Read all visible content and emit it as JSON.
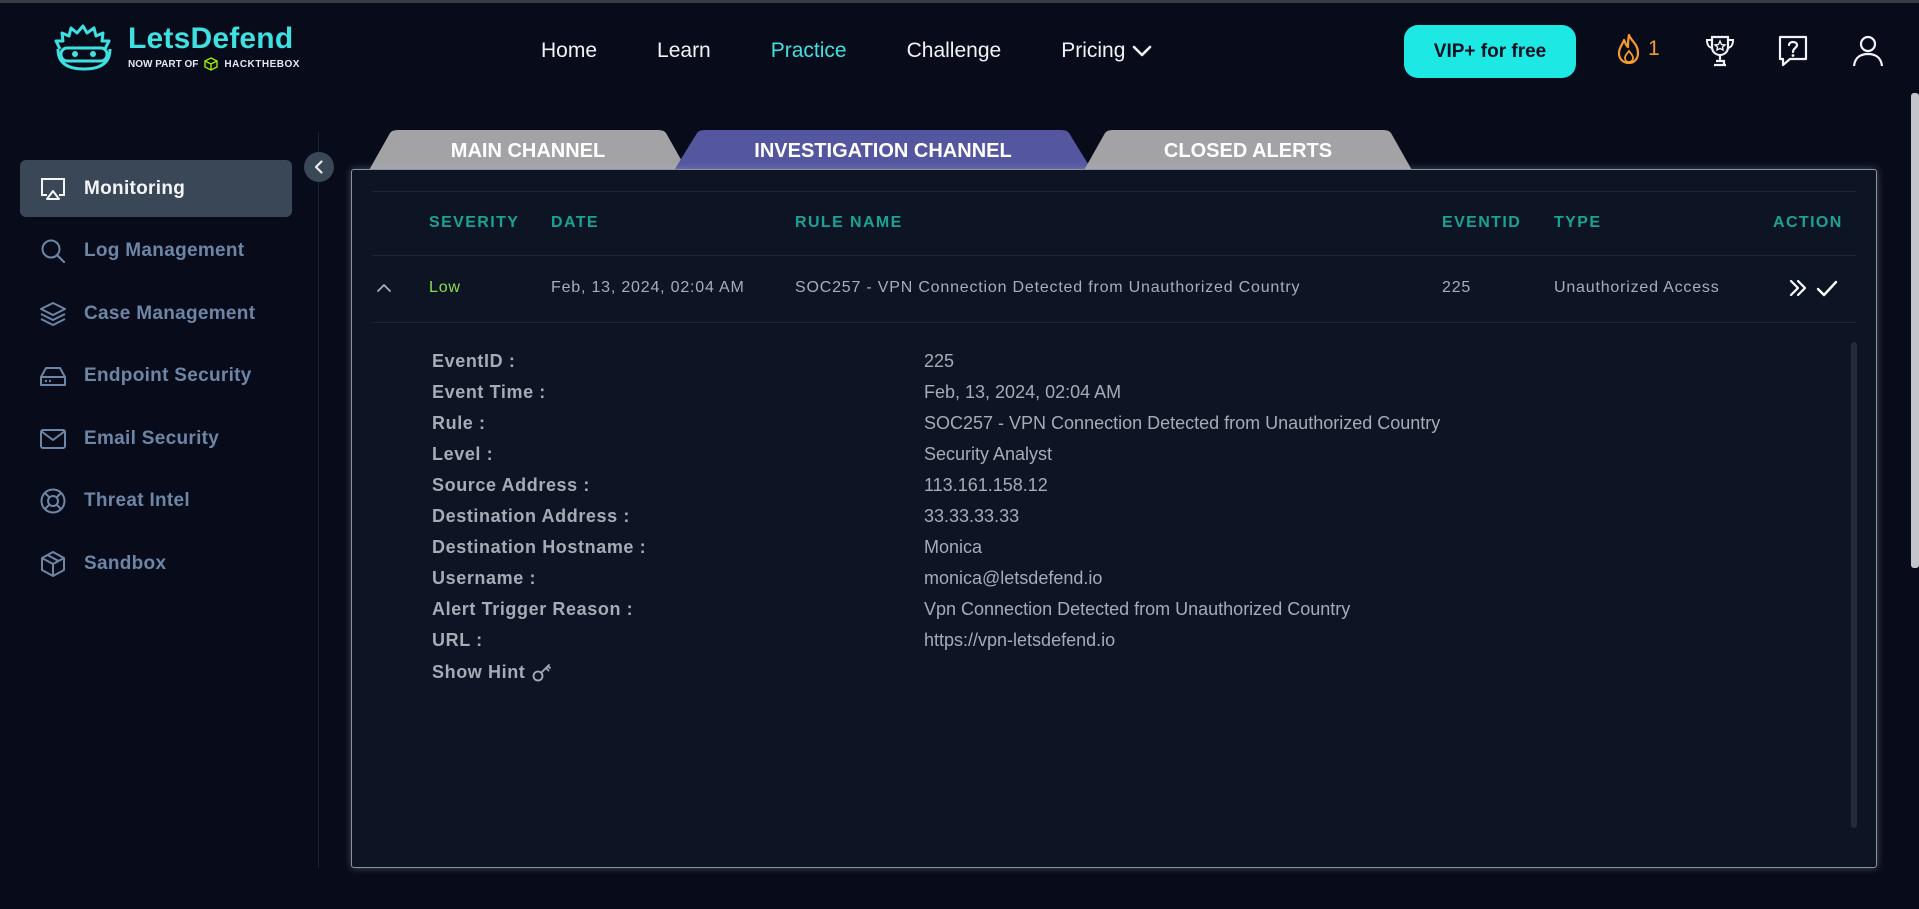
{
  "brand": {
    "name": "LetsDefend",
    "sub_prefix": "NOW PART OF",
    "sub_partner": "HACKTHEBOX",
    "accent": "#3ee0e0"
  },
  "nav": {
    "links": [
      {
        "label": "Home"
      },
      {
        "label": "Learn"
      },
      {
        "label": "Practice",
        "active": true
      },
      {
        "label": "Challenge"
      },
      {
        "label": "Pricing",
        "dropdown": true
      }
    ],
    "vip_label": "VIP+ for free",
    "streak_count": "1",
    "icons": [
      "flame-icon",
      "trophy-icon",
      "help-icon",
      "user-icon"
    ]
  },
  "sidebar": {
    "items": [
      {
        "label": "Monitoring",
        "icon": "monitor-icon",
        "active": true
      },
      {
        "label": "Log Management",
        "icon": "search-icon"
      },
      {
        "label": "Case Management",
        "icon": "layers-icon"
      },
      {
        "label": "Endpoint Security",
        "icon": "hard-drive-icon"
      },
      {
        "label": "Email Security",
        "icon": "mail-icon"
      },
      {
        "label": "Threat Intel",
        "icon": "lifebuoy-icon"
      },
      {
        "label": "Sandbox",
        "icon": "box-icon"
      }
    ]
  },
  "tabs": [
    {
      "label": "MAIN CHANNEL",
      "color": "#a3a3a6"
    },
    {
      "label": "INVESTIGATION CHANNEL",
      "color": "#5456a0",
      "active": true
    },
    {
      "label": "CLOSED ALERTS",
      "color": "#a3a3a6"
    }
  ],
  "table": {
    "headers": {
      "severity": "SEVERITY",
      "date": "DATE",
      "rule_name": "RULE NAME",
      "eventid": "EVENTID",
      "type": "TYPE",
      "action": "ACTION"
    },
    "row": {
      "severity": "Low",
      "date": "Feb, 13, 2024, 02:04 AM",
      "rule_name": "SOC257 - VPN Connection Detected from Unauthorized Country",
      "eventid": "225",
      "type": "Unauthorized Access"
    }
  },
  "details": [
    {
      "label": "EventID :",
      "value": "225"
    },
    {
      "label": "Event Time :",
      "value": "Feb, 13, 2024, 02:04 AM"
    },
    {
      "label": "Rule :",
      "value": "SOC257 - VPN Connection Detected from Unauthorized Country"
    },
    {
      "label": "Level :",
      "value": "Security Analyst"
    },
    {
      "label": "Source Address :",
      "value": "113.161.158.12"
    },
    {
      "label": "Destination Address :",
      "value": "33.33.33.33"
    },
    {
      "label": "Destination Hostname :",
      "value": "Monica"
    },
    {
      "label": "Username :",
      "value": "monica@letsdefend.io"
    },
    {
      "label": "Alert Trigger Reason :",
      "value": "Vpn Connection Detected from Unauthorized Country"
    },
    {
      "label": "URL :",
      "value": "https://vpn-letsdefend.io"
    }
  ],
  "hint_label": "Show Hint"
}
